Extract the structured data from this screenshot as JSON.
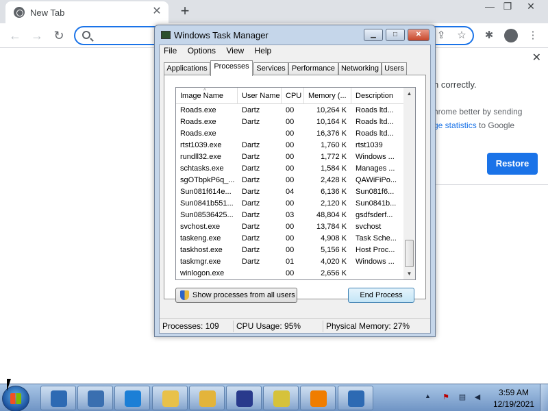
{
  "browser": {
    "tab_title": "New Tab",
    "tab_close": "✕",
    "new_tab": "+",
    "win_min": "—",
    "win_max": "❐",
    "win_close": "✕",
    "nav_back": "←",
    "nav_forward": "→",
    "nav_reload": "↻",
    "share": "⇪",
    "star": "☆",
    "extensions": "✱",
    "menu": "⋮"
  },
  "restore_bubble": {
    "close": "✕",
    "line1": "n correctly.",
    "line2": "hrome better by sending",
    "link": "ge statistics",
    "line3_suffix": " to Google",
    "button": "Restore"
  },
  "task_manager": {
    "title": "Windows Task Manager",
    "controls": {
      "min": "▁",
      "max": "□",
      "close": "✕"
    },
    "menu": [
      "File",
      "Options",
      "View",
      "Help"
    ],
    "tabs": [
      "Applications",
      "Processes",
      "Services",
      "Performance",
      "Networking",
      "Users"
    ],
    "active_tab": "Processes",
    "columns": [
      "Image Name",
      "User Name",
      "CPU",
      "Memory (...",
      "Description"
    ],
    "sort_indicator": "^",
    "rows": [
      [
        "Roads.exe",
        "Dartz",
        "00",
        "10,264 K",
        "Roads ltd..."
      ],
      [
        "Roads.exe",
        "Dartz",
        "00",
        "10,164 K",
        "Roads ltd..."
      ],
      [
        "Roads.exe",
        "",
        "00",
        "16,376 K",
        "Roads ltd..."
      ],
      [
        "rtst1039.exe",
        "Dartz",
        "00",
        "1,760 K",
        "rtst1039"
      ],
      [
        "rundll32.exe",
        "Dartz",
        "00",
        "1,772 K",
        "Windows ..."
      ],
      [
        "schtasks.exe",
        "Dartz",
        "00",
        "1,584 K",
        "Manages ..."
      ],
      [
        "sgOTbpkP6q_...",
        "Dartz",
        "00",
        "2,428 K",
        "QAWiFiPo..."
      ],
      [
        "Sun081f614e...",
        "Dartz",
        "04",
        "6,136 K",
        "Sun081f6..."
      ],
      [
        "Sun0841b551...",
        "Dartz",
        "00",
        "2,120 K",
        "Sun0841b..."
      ],
      [
        "Sun08536425...",
        "Dartz",
        "03",
        "48,804 K",
        "gsdfsderf..."
      ],
      [
        "svchost.exe",
        "Dartz",
        "00",
        "13,784 K",
        "svchost"
      ],
      [
        "taskeng.exe",
        "Dartz",
        "00",
        "4,908 K",
        "Task Sche..."
      ],
      [
        "taskhost.exe",
        "Dartz",
        "00",
        "5,156 K",
        "Host Proc..."
      ],
      [
        "taskmgr.exe",
        "Dartz",
        "01",
        "4,020 K",
        "Windows ..."
      ],
      [
        "winlogon.exe",
        "",
        "00",
        "2,656 K",
        ""
      ]
    ],
    "show_all_button": "Show processes from all users",
    "end_process_button": "End Process",
    "status": {
      "processes": "Processes: 109",
      "cpu": "CPU Usage: 95%",
      "memory": "Physical Memory: 27%"
    }
  },
  "taskbar": {
    "items": [
      "ace-app-icon",
      "teamviewer-icon",
      "slack-icon",
      "folder-icon",
      "vortex-icon",
      "folder-icon",
      "vlc-icon",
      "tree-app-icon",
      "task-manager-icon"
    ],
    "tray_arrow": "▲",
    "time": "3:59 AM",
    "date": "12/19/2021"
  }
}
